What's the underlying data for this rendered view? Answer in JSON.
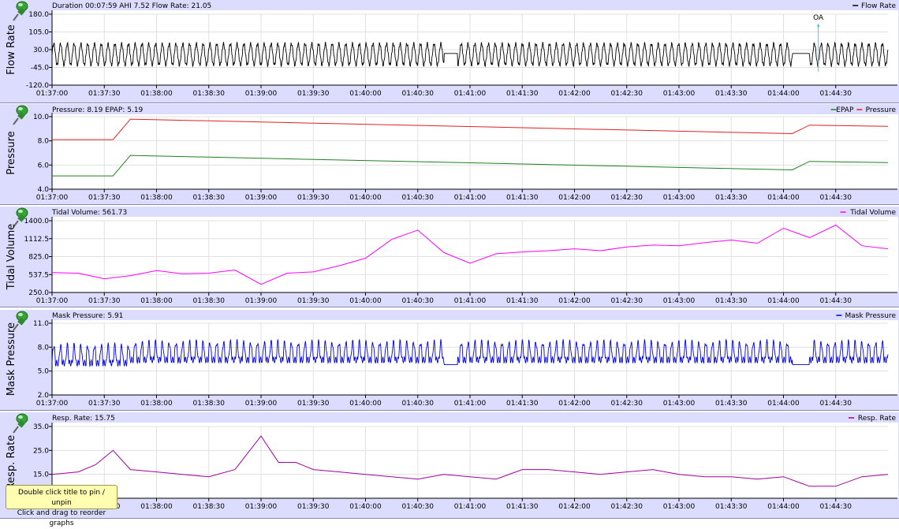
{
  "colors": {
    "panel_bg": "#dcdcff",
    "grid": "#e0e0e0",
    "flow_rate": "#000000",
    "pressure": "#e02020",
    "epap": "#208020",
    "tidal_volume": "#ff00ff",
    "mask_pressure": "#0000dd",
    "resp_rate": "#a000a0",
    "event_oa": "#4fc3f7"
  },
  "pin_icon": "pushpin-icon",
  "x_tick_labels": [
    "01:37:00",
    "01:37:30",
    "01:38:00",
    "01:38:30",
    "01:39:00",
    "01:39:30",
    "01:40:00",
    "01:40:30",
    "01:41:00",
    "01:41:30",
    "01:42:00",
    "01:42:30",
    "01:43:00",
    "01:43:30",
    "01:44:00",
    "01:44:30"
  ],
  "tooltip": {
    "line1": "Double click title to pin / unpin",
    "line2": "Click and drag to reorder graphs"
  },
  "graphs": [
    {
      "name": "flow-rate",
      "side_title": "Flow Rate",
      "header": "Duration 00:07:59 AHI 7.52 Flow Rate: 21.05",
      "legend": [
        "Flow Rate"
      ],
      "y_ticks": [
        "180.0",
        "105.0",
        "30.0",
        "-45.0",
        "-120.0"
      ],
      "event_label": "OA"
    },
    {
      "name": "pressure",
      "side_title": "Pressure",
      "header": "Pressure: 8.19 EPAP: 5.19",
      "legend": [
        "EPAP",
        "Pressure"
      ],
      "y_ticks": [
        "10.0",
        "8.0",
        "6.0",
        "4.0"
      ]
    },
    {
      "name": "tidal-volume",
      "side_title": "Tidal Volume",
      "header": "Tidal Volume: 561.73",
      "legend": [
        "Tidal Volume"
      ],
      "y_ticks": [
        "1400.0",
        "1112.5",
        "825.0",
        "537.5",
        "250.0"
      ]
    },
    {
      "name": "mask-pressure",
      "side_title": "Mask Pressure",
      "header": "Mask Pressure: 5.91",
      "legend": [
        "Mask Pressure"
      ],
      "y_ticks": [
        "11.0",
        "8.0",
        "5.0",
        "2.0"
      ]
    },
    {
      "name": "resp-rate",
      "side_title": "Resp. Rate",
      "header": "Resp. Rate: 15.75",
      "legend": [
        "Resp. Rate"
      ],
      "y_ticks": [
        "35.0",
        "25.0",
        "15.0"
      ]
    }
  ],
  "chart_data": [
    {
      "type": "line",
      "title": "Duration 00:07:59 AHI 7.52 Flow Rate: 21.05",
      "ylabel": "Flow Rate",
      "ylim": [
        -120,
        180
      ],
      "x_range": [
        "01:37:00",
        "01:45:00"
      ],
      "series": [
        {
          "name": "Flow Rate",
          "amplitude": [
            -45,
            60
          ]
        }
      ],
      "events": [
        {
          "label": "OA",
          "x": "01:44:20"
        }
      ]
    },
    {
      "type": "line",
      "title": "Pressure: 8.19 EPAP: 5.19",
      "ylabel": "Pressure",
      "ylim": [
        4,
        10
      ],
      "x_range": [
        "01:37:00",
        "01:45:00"
      ],
      "series": [
        {
          "name": "Pressure",
          "x": [
            "01:37:00",
            "01:37:35",
            "01:37:45",
            "01:44:05",
            "01:44:15",
            "01:45:00"
          ],
          "values": [
            8.1,
            8.1,
            9.8,
            8.6,
            9.3,
            9.2
          ]
        },
        {
          "name": "EPAP",
          "x": [
            "01:37:00",
            "01:37:35",
            "01:37:45",
            "01:44:05",
            "01:44:15",
            "01:45:00"
          ],
          "values": [
            5.1,
            5.1,
            6.8,
            5.6,
            6.3,
            6.2
          ]
        }
      ]
    },
    {
      "type": "line",
      "title": "Tidal Volume: 561.73",
      "ylabel": "Tidal Volume",
      "ylim": [
        250,
        1400
      ],
      "x_range": [
        "01:37:00",
        "01:45:00"
      ],
      "series": [
        {
          "name": "Tidal Volume",
          "x": [
            "01:37:00",
            "01:37:15",
            "01:37:30",
            "01:37:45",
            "01:38:00",
            "01:38:15",
            "01:38:30",
            "01:38:45",
            "01:39:00",
            "01:39:15",
            "01:39:30",
            "01:39:45",
            "01:40:00",
            "01:40:15",
            "01:40:30",
            "01:40:45",
            "01:41:00",
            "01:41:15",
            "01:41:30",
            "01:41:45",
            "01:42:00",
            "01:42:15",
            "01:42:30",
            "01:42:45",
            "01:43:00",
            "01:43:15",
            "01:43:30",
            "01:43:45",
            "01:44:00",
            "01:44:15",
            "01:44:30",
            "01:44:45",
            "01:45:00"
          ],
          "values": [
            570,
            560,
            470,
            520,
            600,
            550,
            560,
            610,
            380,
            560,
            580,
            680,
            800,
            1100,
            1250,
            890,
            720,
            870,
            900,
            920,
            950,
            920,
            980,
            1010,
            1000,
            1050,
            1090,
            1040,
            1280,
            1130,
            1330,
            1000,
            950
          ]
        }
      ]
    },
    {
      "type": "line",
      "title": "Mask Pressure: 5.91",
      "ylabel": "Mask Pressure",
      "ylim": [
        2,
        11
      ],
      "x_range": [
        "01:37:00",
        "01:45:00"
      ],
      "series": [
        {
          "name": "Mask Pressure",
          "amplitude": [
            5,
            10
          ]
        }
      ]
    },
    {
      "type": "line",
      "title": "Resp. Rate: 15.75",
      "ylabel": "Resp. Rate",
      "ylim": [
        5,
        35
      ],
      "x_range": [
        "01:37:00",
        "01:45:00"
      ],
      "series": [
        {
          "name": "Resp. Rate",
          "x": [
            "01:37:00",
            "01:37:15",
            "01:37:25",
            "01:37:35",
            "01:37:45",
            "01:38:00",
            "01:38:15",
            "01:38:30",
            "01:38:45",
            "01:39:00",
            "01:39:10",
            "01:39:20",
            "01:39:30",
            "01:39:45",
            "01:40:00",
            "01:40:15",
            "01:40:30",
            "01:40:45",
            "01:41:00",
            "01:41:15",
            "01:41:30",
            "01:41:45",
            "01:42:00",
            "01:42:15",
            "01:42:30",
            "01:42:45",
            "01:43:00",
            "01:43:15",
            "01:43:30",
            "01:43:45",
            "01:44:00",
            "01:44:15",
            "01:44:30",
            "01:44:45",
            "01:45:00"
          ],
          "values": [
            15,
            16,
            19,
            25,
            17,
            16,
            15,
            14,
            17,
            31,
            20,
            20,
            17,
            16,
            15,
            14,
            13,
            15,
            14,
            13,
            17,
            17,
            16,
            15,
            16,
            17,
            15,
            14,
            14,
            13,
            14,
            10,
            10,
            14,
            15
          ]
        }
      ]
    }
  ]
}
